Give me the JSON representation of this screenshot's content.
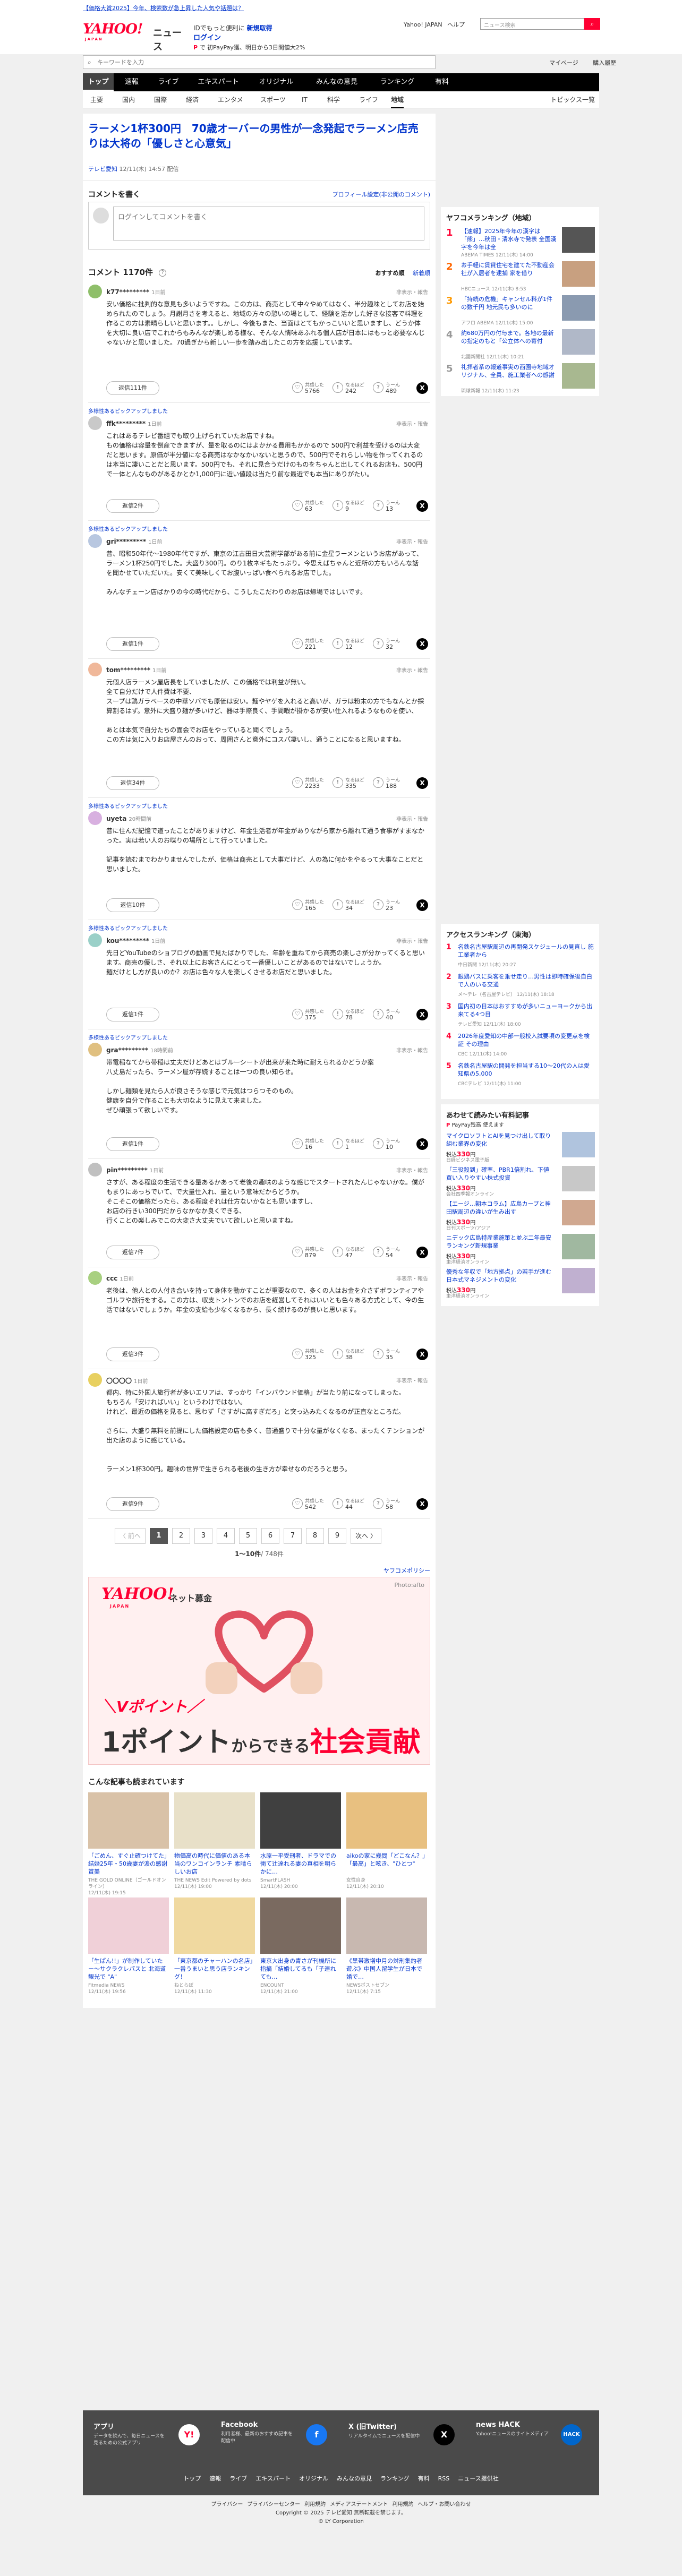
{
  "promo": {
    "text": "【価格大賞2025】今年、検索数が急上昇した人気や話題は？",
    "link": "今年、検索数が急上昇した人気や話題は？"
  },
  "header": {
    "logo": "YAHOO!",
    "logo_sub": "JAPAN",
    "service": "ニュース",
    "tagline": "IDでもっと便利に",
    "register": "新規取得",
    "login": "ログイン",
    "paypay": "で 初PayPay獲、明日から3日間値大2%",
    "links": [
      "Yahoo! JAPAN",
      "ヘルプ"
    ],
    "search_placeholder": "ニュース検索"
  },
  "searchbar": {
    "placeholder": "キーワードを入力",
    "links": [
      "マイページ",
      "購入履歴"
    ]
  },
  "nav": {
    "tabs": [
      "トップ",
      "速報",
      "ライブ",
      "エキスパート",
      "オリジナル",
      "みんなの意見",
      "ランキング",
      "有料"
    ],
    "sub": [
      "主要",
      "国内",
      "国際",
      "経済",
      "エンタメ",
      "スポーツ",
      "IT",
      "科学",
      "ライフ",
      "地域"
    ],
    "topics": "トピックス一覧"
  },
  "article": {
    "title": "ラーメン1杯300円　70歳オーバーの男性が一念発起でラーメン店売りは大将の「優しさと心意気」",
    "source": "テレビ愛知",
    "date": "12/11(木) 14:57",
    "delivery": "配信"
  },
  "comment_area": {
    "title": "コメントを書く",
    "profile_link": "プロフィール設定(非公開のコメント)",
    "placeholder": "ログインしてコメントを書く",
    "count_label": "コメント",
    "count": "1170件",
    "help": "?",
    "sort_recommended": "おすすめ順",
    "sort_newest": "新着順"
  },
  "reaction_labels": [
    "共感した",
    "なるほど",
    "うーん"
  ],
  "comments": [
    {
      "name": "k77*********",
      "time": "1日前",
      "report": "非表示・報告",
      "text": "安い価格に批判的な意見も多いようですね。この方は、商売として中々やめてはなく、半分趣味としてお店を始められたのでしょう。月謝月さを考えると、地域の方々の憩いの場として、経験を活かした好きな接客で料理を作るこの方は素晴らしいと思います。。しかし、今後もまた、当面はとてもかっこいいと思いますし、どうか体を大切に良い店でこれからもみんなが楽しめる様な、そんな人情味あふれる個人店が日本にはもっと必要なんじゃないかと思いました。70過ぎから新しい一歩を踏み出したこの方を応援しています。",
      "reply": "返信111件",
      "reacts": [
        "5766",
        "242",
        "489"
      ]
    },
    {
      "pickup": "多様性あるピックアップしました",
      "name": "ffk*********",
      "time": "1日前",
      "report": "非表示・報告",
      "text": "これはあるテレビ番組でも取り上げられていたお店ですね。\nもの価格は容量を倒産できますが、量を取るのにはよかかる費用もかかるので 500円で利益を受けるのは大変だと思います。原価が半分値になる商売はなかなかいないと思うので、500円でそれらしい物を作ってくれるのは本当に凄いことだと思います。500円でも、それに見合うだけのものをちゃんと出してくれるお店も、500円で一体とんなものがあるかとか1,000円に近い値段は当たり前な最近でも本当にありがたい。",
      "reply": "返信2件",
      "reacts": [
        "63",
        "9",
        "13"
      ]
    },
    {
      "pickup": "多様性あるピックアップしました",
      "name": "gri*********",
      "time": "1日前",
      "report": "非表示・報告",
      "text": "昔、昭和50年代〜1980年代ですが、東京の江古田日大芸術学部がある前に金星ラーメンというお店があって、ラーメン1杯250円でした。大盛り300円。のり1枚ネギもたっぷり。今思えばちゃんと近所の方もいろんな話を聞かせていただいた。安くて美味しくてお腹いっぱい食べられるお店でした。\n\nみんなチェーン店ばかりの今の時代だから、こうしたこだわりのお店は帰場ではしいです。",
      "reply": "返信1件",
      "reacts": [
        "221",
        "12",
        "32"
      ]
    },
    {
      "name": "tom*********",
      "time": "1日前",
      "report": "非表示・報告",
      "text": "元個人店ラーメン屋店長をしていましたが、この価格では利益が無い。\n全て自分だけで人件費は不要、\nスープは鶏ガラベースの中華ソバでも原価は安い。麺やヤゲを入れると高いが、ガラは粉末の方でもなんとか採算割るはず。意外に大盛り麺が多いけど、器は手際良く、手間暇が掛かるが安い仕入れるようなものを使い、\n\nあとは本気で自分たちの面会でお店をやっていると聞くでしょう。\nこの方は気に入りお店屋さんのおって、周囲さんと意外にコスパ凄いし、通うことになると思いますね。",
      "reply": "返信34件",
      "reacts": [
        "2233",
        "335",
        "188"
      ]
    },
    {
      "pickup": "多様性あるピックアップしました",
      "name": "uyeta",
      "time": "20時間前",
      "report": "非表示・報告",
      "text": "昔に住んだ記憶で道ったことがありますけど、年金生活者が年金がありながら家から離れて通う食事がすまなかった。実は若い人のお喋りの場所として行っていました。\n\n記事を読むまでわかりませんでしたが、価格は商売として大事だけど、人の為に何かをやるって大事なことだと思いました。",
      "reply": "返信10件",
      "reacts": [
        "165",
        "34",
        "23"
      ]
    },
    {
      "pickup": "多様性あるピックアップしました",
      "name": "kou*********",
      "time": "1日前",
      "report": "非表示・報告",
      "text": "先日どYouTubeのショブログの動画で見たばかりでした、年齢を重ねてから商売の楽しさが分かってくると思います。商売の優しさ、それ以上にお客さんにとって一番優しいことがあるのではないでしょうか。\n麺だけとし方が良いのか？お店は色々な人を楽しくさせるお店だと思いました。",
      "reply": "返信1件",
      "reacts": [
        "375",
        "78",
        "40"
      ]
    },
    {
      "pickup": "多様性あるピックアップしました",
      "name": "gra*********",
      "time": "18時間前",
      "report": "非表示・報告",
      "text": "帯電稲なてから帯稲は丈夫だけどあとはブルーシートが出来が来た時に耐えられるかどうか案\n八丈島だったら、ラーメン屋が存続することは一つの良い知らせ。\n\nしかし麺類を見たら人が良さそうな感じで元気はつらつそのもの。\n健康を自分で作ることも大切なように見えて来ました。\nぜひ頑張って欲しいです。",
      "reply": "返信1件",
      "reacts": [
        "16",
        "1",
        "10"
      ]
    },
    {
      "name": "pin*********",
      "time": "1日前",
      "report": "非表示・報告",
      "text": "さすが、ある程度の生活できる量あるかあって老後の趣味のような感じでスタートされたんじゃないかな。僕がもまりにあっちでいて、で大量仕入れ、量という意味だからどうか。\nそこそこの価格だったら、ある程度それは仕方ないかなとも思いますし、\nお店の行きい300円だからなかなか良くできる、\n行くことの楽しみでこの大変さ大丈夫でいて欲しいと思いますね。",
      "reply": "返信7件",
      "reacts": [
        "879",
        "47",
        "54"
      ]
    },
    {
      "name": "ccc",
      "time": "1日前",
      "report": "非表示・報告",
      "text": "老後は、他人との人付き合いを持って身体を動かすことが重要なので、多くの人はお金を介さずボランティアやゴルフや旅行をする。この方は、収支トントンでのお店を経営してそれはいいとも色々ある方式として、今の生活ではないでしょうか。年金の支給も少なくなるから、長く続けるのが良いと思います。",
      "reply": "返信3件",
      "reacts": [
        "325",
        "38",
        "35"
      ]
    },
    {
      "name": "〇〇〇〇",
      "time": "1日前",
      "report": "非表示・報告",
      "text": "都内、特に外国人旅行者が多いエリアは、すっかり「インバウンド価格」が当たり前になってしまった。\nもちろん「安ければいい」というわけではない。\nけれど、最近の価格を見ると、思わず「さすがに高すぎだろ」と突っ込みたくなるのが正直なところだ。\n\nさらに、大盛り無料を前提にした価格設定の店も多く、普通盛りで十分な量がなくなる、まったくテンションが出た店のように感じている。\n\n\nラーメン1杯300円。趣味の世界で生きられる老後の生き方が幸せなのだろうと思う。",
      "reply": "返信9件",
      "reacts": [
        "542",
        "44",
        "58"
      ]
    }
  ],
  "pager": {
    "prev": "〈 前へ",
    "pages": [
      "1",
      "2",
      "3",
      "4",
      "5",
      "6",
      "7",
      "8",
      "9"
    ],
    "next": "次へ 〉",
    "range": "1〜10件",
    "total": "/ 748件",
    "guide": "ヤフコメポリシー"
  },
  "ad": {
    "logo": "YAHOO!",
    "logo_sub": "JAPAN",
    "kind": "ネット募金",
    "credit": "Photo:afto",
    "line1": "＼Vポイント／",
    "line2_a": "1ポイント",
    "line2_b": "からできる",
    "line2_c": "社会貢献"
  },
  "recommended": {
    "title": "こんな記事も読まれています",
    "items": [
      {
        "title": "「ごめん、すぐ止確つけてた」結婚25年・50歳妻が涙の感謝賞美",
        "source": "THE GOLD ONLINE（ゴールドオンライン）",
        "date": "12/11(木) 19:15"
      },
      {
        "title": "物価高の時代に価値のある本当のワンコインランチ 素晴らしいお店",
        "source": "THE NEWS Edit Powered by dots",
        "date": "12/11(木) 19:00"
      },
      {
        "title": "水原一平受刑者、ドラマでの衝て辻達れる妻の真相を明らかに…",
        "source": "SmartFLASH",
        "date": "12/11(木) 20:00"
      },
      {
        "title": "aikoの家に幾問「どこなん？」「最高」と呟き、\"ひとつ\"",
        "source": "女性自身",
        "date": "12/11(木) 20:10"
      },
      {
        "title": "「生ぱん!!」が制作していたー〜サクラクレパスと 北海道観光で \"A\"",
        "source": "Fitmedia NEWS",
        "date": "12/11(木) 19:56"
      },
      {
        "title": "「東京都のチャーハンの名店」一番うまいと思う店ランキング！",
        "source": "ねとらぼ",
        "date": "12/11(木) 11:30"
      },
      {
        "title": "東京大出身の青さが刊機所に指摘「結婚してるも「子連れても…",
        "source": "ENCOUNT",
        "date": "12/11(木) 21:00"
      },
      {
        "title": "《黒帯激増中月の対刑集約者遊ぶ》中国人留学生が日本で婚で…",
        "source": "NEWSポストセブン",
        "date": "12/11(木) 7:15"
      }
    ]
  },
  "sidebar": {
    "ranking": {
      "title": "ヤフコメランキング（地域）",
      "items": [
        {
          "rank": "1",
          "title": "【速報】2025年今年の漢字は「熊」…秋田・清水寺で発表 全国漢字を今年は全",
          "source": "ABEMA TIMES",
          "date": "12/11(木) 14:00"
        },
        {
          "rank": "2",
          "title": "お手軽に賃貸住宅を建てた不動産会社が入居者を逮捕 家を借り",
          "source": "HBCニュース",
          "date": "12/11(木) 8:53",
          "count": "コメ"
        },
        {
          "rank": "3",
          "title": "「持続の危機」キャンセル料が1件の数千円 地元民も多いのに",
          "source": "アフロ ABEMA",
          "date": "12/11(木) 15:00"
        },
        {
          "rank": "4",
          "title": "約680万円の付与まで。各地の最新の指定のもと「公立体への寄付",
          "source": "北國新聞社",
          "date": "12/11(木) 10:21"
        },
        {
          "rank": "5",
          "title": "礼拝者系の報道事実の西園寺地域オリジナル、全員、施工業者への感謝",
          "source": "琉球新報",
          "date": "12/11(木) 11:23"
        }
      ]
    },
    "access": {
      "title": "アクセスランキング（東海）",
      "items": [
        {
          "rank": "1",
          "title": "名鉄名古屋駅周辺の再開発スケジュールの見直し 施工業者から",
          "source": "中日新聞",
          "date": "12/11(木) 20:27"
        },
        {
          "rank": "2",
          "title": "銀鶏バスに乗客を乗せ走り…男性は即時確保後自白で人のいる交通",
          "source": "メ～テレ（名古屋テレビ）",
          "date": "12/11(木) 18:18"
        },
        {
          "rank": "3",
          "title": "国内初の日本はおすすめが多いニューヨークから出来てる4つ目",
          "source": "テレビ愛知",
          "date": "12/11(木) 18:00"
        },
        {
          "rank": "4",
          "title": "2026年度愛知の中部一般校入試要項の変更点を検証 その理由",
          "source": "CBC",
          "date": "12/11(木) 14:00"
        },
        {
          "rank": "5",
          "title": "名鉄名古屋駅の開発を担当する10～20代の人は愛知県の5,000",
          "source": "CBCテレビ",
          "date": "12/11(木) 11:00"
        }
      ]
    },
    "paid": {
      "title": "あわせて読みたい有料記事",
      "sub": "PayPay残高 使えます",
      "items": [
        {
          "title": "マイクロソフトとAIを見つけ出して取り組む業界の変化",
          "source": "日経ビジネス電子版",
          "price": "330"
        },
        {
          "title": "「三役殺到」確率、PBR1倍割れ、下値買い入りやすい株式投資",
          "source": "会社四季報オンライン",
          "price": "330"
        },
        {
          "title": "【エージ…朝本コラム】広島カープと神田駅周辺の違いが生み出す",
          "source": "日刊スポーツ/アジア",
          "price": "330"
        },
        {
          "title": "ニデック広島特産業施策と並ぶ二年最安ランキング新規事業",
          "source": "東洋経済オンライン",
          "price": "330"
        },
        {
          "title": "優秀な年収で「地方拠点」の若手が進む日本式マネジメントの変化",
          "source": "東洋経済オンライン",
          "price": "330"
        }
      ]
    }
  },
  "footer": {
    "cols": [
      {
        "title": "アプリ",
        "desc": "データを読んで、毎日ニュースを見るための公式アプリ",
        "icon": "Y!"
      },
      {
        "title": "Facebook",
        "desc": "利用者様、最新のおすすめ記事を配信中",
        "icon": "f"
      },
      {
        "title": "X (旧Twitter)",
        "desc": "リアルタイムでニュースを配信中",
        "icon": "X"
      },
      {
        "title": "news HACK",
        "desc": "Yahoo!ニュースのサイトメディア",
        "icon": "HACK"
      }
    ],
    "links": [
      "トップ",
      "速報",
      "ライブ",
      "エキスパート",
      "オリジナル",
      "みんなの意見",
      "ランキング",
      "有料",
      "RSS",
      "ニュース提供社"
    ],
    "legal1": [
      "プライバシー",
      "プライバシーセンター",
      "利用規約",
      "メディアステートメント",
      "利用規約",
      "ヘルプ・お問い合わせ"
    ],
    "copyright": "Copyright © 2025 テレビ愛知 無断転載を禁じます。",
    "copyright2": "© LY Corporation"
  }
}
